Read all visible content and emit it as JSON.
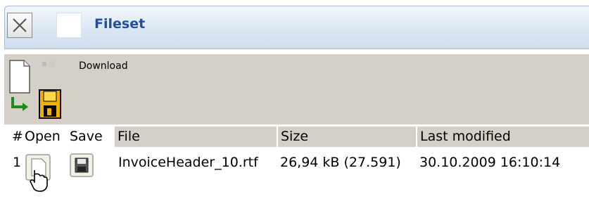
{
  "window": {
    "title": "Fileset",
    "close_icon": "close-x-icon"
  },
  "toolbar": {
    "download_label": "Download",
    "icons": [
      "document-icon",
      "green-arrow-icon",
      "floppy-disk-icon"
    ]
  },
  "table": {
    "columns": [
      "#",
      "Open",
      "Save",
      "File",
      "Size",
      "Last modified"
    ],
    "rows": [
      {
        "index": "1",
        "open_icon": "document-hand-icon",
        "save_icon": "floppy-disk-icon",
        "file": "InvoiceHeader_10.rtf",
        "size": "26,94 kB (27.591)",
        "modified": "30.10.2009 16:10:14"
      }
    ]
  },
  "colors": {
    "title_text": "#1f4fa3",
    "title_bar": "#dbe6f3",
    "panel_gray": "#d4d0c8"
  }
}
